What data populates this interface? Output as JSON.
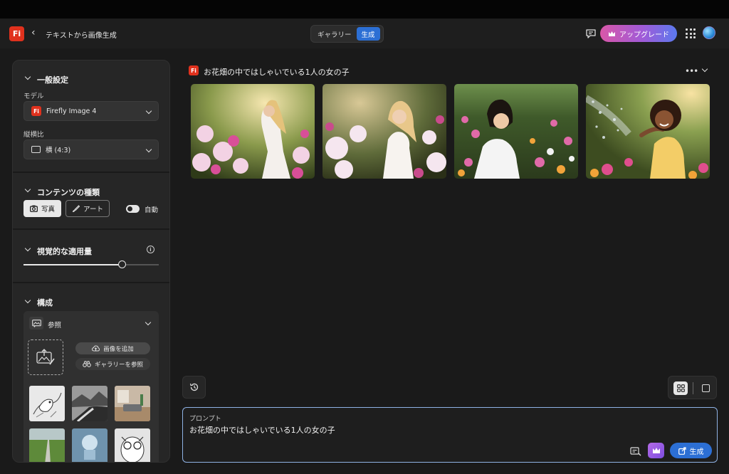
{
  "header": {
    "app_logo": "Fi",
    "back_icon": "‹",
    "title": "テキストから画像生成",
    "tabs": [
      {
        "label": "ギャラリー",
        "active": false
      },
      {
        "label": "生成",
        "active": true
      }
    ],
    "upgrade_label": "アップグレード"
  },
  "sidebar": {
    "general": {
      "title": "一般設定",
      "model_label": "モデル",
      "model_value": "Firefly Image 4",
      "model_badge": "Fi",
      "aspect_label": "縦横比",
      "aspect_value": "横 (4:3)"
    },
    "content_type": {
      "title": "コンテンツの種類",
      "photo_label": "写真",
      "art_label": "アート",
      "auto_label": "自動",
      "auto_on": true
    },
    "visual_intensity": {
      "title": "視覚的な適用量",
      "info_icon": "i",
      "level": 0.73
    },
    "composition": {
      "title": "構成",
      "reference_label": "参照",
      "add_image_label": "画像を追加",
      "browse_gallery_label": "ギャラリーを参照"
    }
  },
  "generation": {
    "badge": "Fi",
    "title": "お花畑の中ではしゃいでいる1人の女の子",
    "more_icon": "•••"
  },
  "prompt": {
    "label": "プロンプト",
    "text": "お花畑の中ではしゃいでいる1人の女の子",
    "generate_label": "生成"
  },
  "colors": {
    "accent_blue": "#2c6fd4",
    "brand_red": "#e0311d",
    "upgrade_gradient_start": "#d957a8",
    "upgrade_gradient_end": "#5b79ee"
  }
}
